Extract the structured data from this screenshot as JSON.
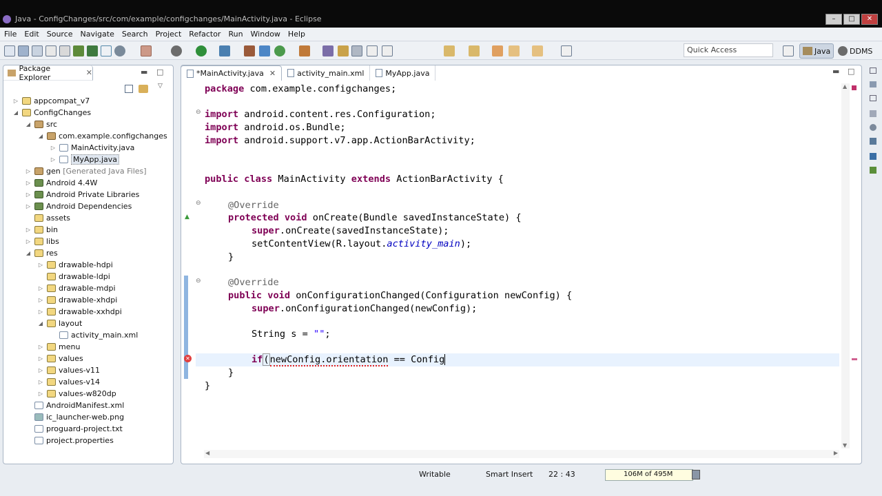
{
  "window": {
    "title": "Java - ConfigChanges/src/com/example/configchanges/MainActivity.java - Eclipse"
  },
  "menu": [
    "File",
    "Edit",
    "Source",
    "Navigate",
    "Search",
    "Project",
    "Refactor",
    "Run",
    "Window",
    "Help"
  ],
  "quick_access": {
    "label": "Quick Access"
  },
  "perspectives": {
    "java": "Java",
    "ddms": "DDMS"
  },
  "package_explorer": {
    "title": "Package Explorer",
    "items": [
      {
        "label": "appcompat_v7"
      },
      {
        "label": "ConfigChanges"
      },
      {
        "label": "src"
      },
      {
        "label": "com.example.configchanges"
      },
      {
        "label": "MainActivity.java"
      },
      {
        "label": "MyApp.java"
      },
      {
        "label": "gen",
        "extra": "[Generated Java Files]"
      },
      {
        "label": "Android 4.4W"
      },
      {
        "label": "Android Private Libraries"
      },
      {
        "label": "Android Dependencies"
      },
      {
        "label": "assets"
      },
      {
        "label": "bin"
      },
      {
        "label": "libs"
      },
      {
        "label": "res"
      },
      {
        "label": "drawable-hdpi"
      },
      {
        "label": "drawable-ldpi"
      },
      {
        "label": "drawable-mdpi"
      },
      {
        "label": "drawable-xhdpi"
      },
      {
        "label": "drawable-xxhdpi"
      },
      {
        "label": "layout"
      },
      {
        "label": "activity_main.xml"
      },
      {
        "label": "menu"
      },
      {
        "label": "values"
      },
      {
        "label": "values-v11"
      },
      {
        "label": "values-v14"
      },
      {
        "label": "values-w820dp"
      },
      {
        "label": "AndroidManifest.xml"
      },
      {
        "label": "ic_launcher-web.png"
      },
      {
        "label": "proguard-project.txt"
      },
      {
        "label": "project.properties"
      }
    ]
  },
  "editor_tabs": [
    {
      "label": "*MainActivity.java"
    },
    {
      "label": "activity_main.xml"
    },
    {
      "label": "MyApp.java"
    }
  ],
  "code": {
    "l1": {
      "kw": "package",
      "rest": " com.example.configchanges;"
    },
    "l2": {
      "kw": "import",
      "rest": " android.content.res.Configuration;"
    },
    "l3": {
      "kw": "import",
      "rest": " android.os.Bundle;"
    },
    "l4": {
      "kw": "import",
      "rest": " android.support.v7.app.ActionBarActivity;"
    },
    "l5": {
      "kw": "public class",
      "mid": " MainActivity ",
      "kw2": "extends",
      "rest": " ActionBarActivity {"
    },
    "l6": {
      "an": "@Override"
    },
    "l7": {
      "kw": "protected void",
      "rest": " onCreate(Bundle savedInstanceState) {"
    },
    "l8": {
      "kw": "super",
      "rest": ".onCreate(savedInstanceState);"
    },
    "l9": {
      "pre": "setContentView(R.layout.",
      "it": "activity_main",
      "rest": ");"
    },
    "l10": {
      "text": "}"
    },
    "l11": {
      "an": "@Override"
    },
    "l12": {
      "kw": "public void",
      "rest": " onConfigurationChanged(Configuration newConfig) {"
    },
    "l13": {
      "kw": "super",
      "rest": ".onConfigurationChanged(newConfig);"
    },
    "l14": {
      "pre": "String s = ",
      "str": "\"\"",
      "rest": ";"
    },
    "l15": {
      "kw": "if",
      "p": "(",
      "err": "newConfig.orientation",
      "rest": " == Config"
    },
    "l16": {
      "text": "}"
    },
    "l17": {
      "text": "}"
    }
  },
  "status": {
    "writable": "Writable",
    "insert": "Smart Insert",
    "position": "22 : 43",
    "heap": "106M of 495M"
  }
}
